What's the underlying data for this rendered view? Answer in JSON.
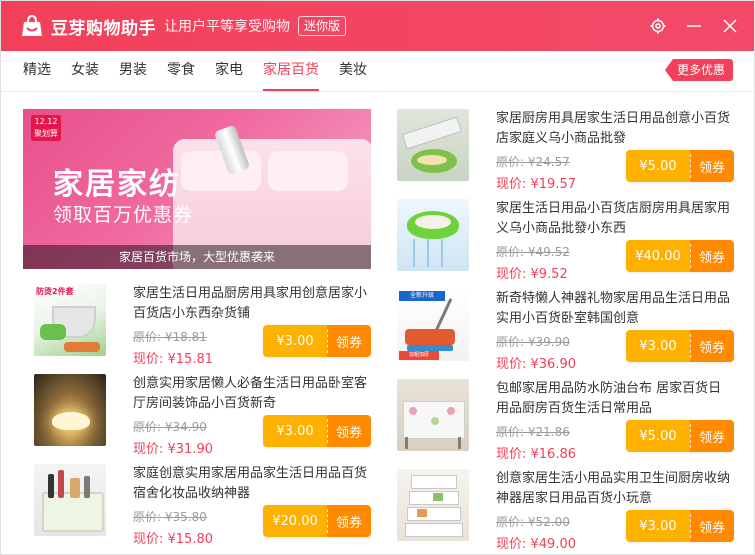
{
  "app": {
    "name": "豆芽购物助手",
    "slogan": "让用户平等享受购物",
    "badge": "迷你版"
  },
  "nav": {
    "tabs": [
      "精选",
      "女装",
      "男装",
      "零食",
      "家电",
      "家居百货",
      "美妆"
    ],
    "active_index": 5,
    "more_offers": "更多优惠"
  },
  "banner": {
    "logo_line1": "聚划算",
    "logo_line2": "12.12",
    "title": "家居家纺",
    "subtitle": "领取百万优惠券",
    "caption": "家居百货市场，大型优惠袭来"
  },
  "products_left": [
    {
      "title": "家居生活日用品厨房用具家用创意居家小百货店小东西杂货铺",
      "orig_price": "原价: ¥18.81",
      "now_price": "现价: ¥15.81",
      "coupon": "¥3.00",
      "get": "领券",
      "thumb_tag": "防烫2件套",
      "thumb_icon": "pot-holder-image"
    },
    {
      "title": "创意实用家居懒人必备生活日用品卧室客厅房间装饰品小百货新奇",
      "orig_price": "原价: ¥34.90",
      "now_price": "现价: ¥31.90",
      "coupon": "¥3.00",
      "get": "领券",
      "thumb_tag": "",
      "thumb_icon": "night-lamp-image"
    },
    {
      "title": "家庭创意实用家居用品家生活日用品百货宿舍化妆品收纳神器",
      "orig_price": "原价: ¥35.80",
      "now_price": "现价: ¥15.80",
      "coupon": "¥20.00",
      "get": "领券",
      "thumb_tag": "",
      "thumb_icon": "storage-box-image"
    }
  ],
  "products_right": [
    {
      "title": "家居厨房用具居家生活日用品创意小百货店家庭义乌小商品批發",
      "orig_price": "原价: ¥24.57",
      "now_price": "现价: ¥19.57",
      "coupon": "¥5.00",
      "get": "领券",
      "thumb_icon": "vegetable-slicer-image"
    },
    {
      "title": "家居生活日用品小百货店厨房用具居家用义乌小商品批發小东西",
      "orig_price": "原价: ¥49.52",
      "now_price": "现价: ¥9.52",
      "coupon": "¥40.00",
      "get": "领券",
      "thumb_icon": "colander-image"
    },
    {
      "title": "新奇特懒人神器礼物家居用品生活日用品实用小百货卧室韩国创意",
      "orig_price": "原价: ¥39.90",
      "now_price": "现价: ¥36.90",
      "coupon": "¥3.00",
      "get": "领券",
      "thumb_icon": "sweeper-image"
    },
    {
      "title": "包邮家居用品防水防油台布 居家百货日用品厨房百货生活日常用品",
      "orig_price": "原价: ¥21.86",
      "now_price": "现价: ¥16.86",
      "coupon": "¥5.00",
      "get": "领券",
      "thumb_icon": "tablecloth-image"
    },
    {
      "title": "创意家居生活小用品实用卫生间厨房收纳神器居家日用品百货小玩意",
      "orig_price": "原价: ¥52.00",
      "now_price": "现价: ¥49.00",
      "coupon": "¥3.00",
      "get": "领券",
      "thumb_icon": "shelf-rack-image"
    }
  ],
  "colors": {
    "brand": "#f3405a",
    "coupon_amount": "#ffb100",
    "coupon_get": "#ff8a00",
    "price_now": "#f3405a",
    "price_orig": "#9b9b9b"
  }
}
